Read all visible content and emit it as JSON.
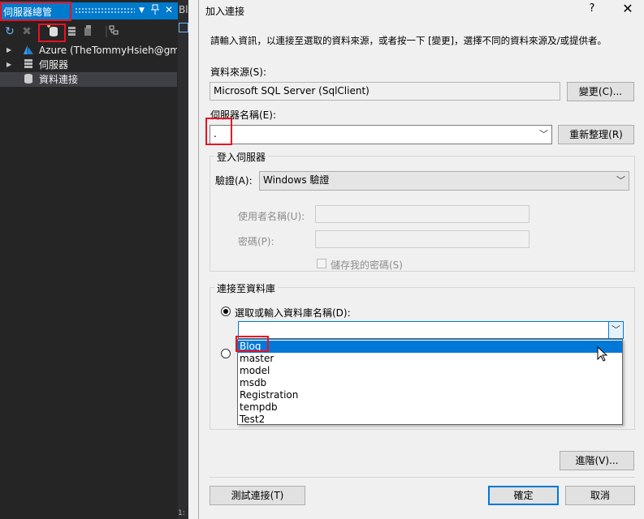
{
  "panel": {
    "title": "伺服器總管",
    "pin_icon": "pin-icon",
    "close_icon": "close-icon",
    "tree": [
      {
        "label": "Azure (TheTommyHsieh@gma",
        "icon": "azure-icon",
        "expandable": true
      },
      {
        "label": "伺服器",
        "icon": "servers-icon",
        "expandable": true
      },
      {
        "label": "資料連接",
        "icon": "data-connections-icon",
        "expandable": false
      }
    ],
    "bottom_text": "1:"
  },
  "tab_fragment": "Bl",
  "dialog": {
    "title": "加入連接",
    "help": "?",
    "close": "✕",
    "intro": "請輸入資訊，以連接至選取的資料來源，或者按一下 [變更]，選擇不同的資料來源及/或提供者。",
    "datasource_label": "資料來源(S):",
    "datasource_value": "Microsoft SQL Server (SqlClient)",
    "change_button": "變更(C)...",
    "server_label": "伺服器名稱(E):",
    "server_value": ".",
    "refresh_button": "重新整理(R)",
    "login_group": "登入伺服器",
    "auth_label": "驗證(A):",
    "auth_value": "Windows 驗證",
    "username_label": "使用者名稱(U):",
    "password_label": "密碼(P):",
    "save_password_label": "儲存我的密碼(S)",
    "connect_group": "連接至資料庫",
    "select_db_label": "選取或輸入資料庫名稱(D):",
    "db_value": "",
    "db_options": [
      "Blog",
      "master",
      "model",
      "msdb",
      "Registration",
      "tempdb",
      "Test2"
    ],
    "db_selected": 0,
    "advanced_button": "進階(V)...",
    "test_button": "測試連接(T)",
    "ok_button": "確定",
    "cancel_button": "取消"
  },
  "colors": {
    "accent": "#007acc",
    "selection": "#0078d7",
    "highlight": "#e81123",
    "panel_bg": "#252526"
  }
}
